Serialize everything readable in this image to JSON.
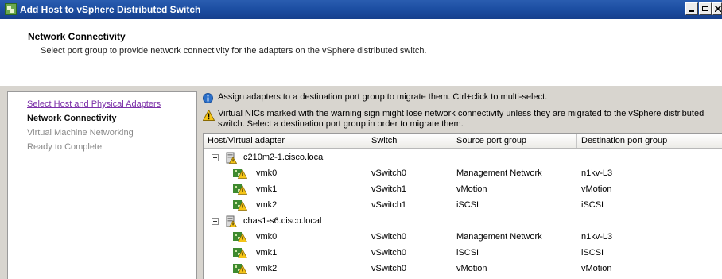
{
  "window": {
    "title": "Add Host to vSphere Distributed Switch"
  },
  "header": {
    "title": "Network Connectivity",
    "subtitle": "Select port group to provide network connectivity for the adapters on the vSphere distributed switch."
  },
  "steps": [
    {
      "label": "Select Host and Physical Adapters",
      "state": "link"
    },
    {
      "label": "Network Connectivity",
      "state": "current"
    },
    {
      "label": "Virtual Machine Networking",
      "state": "disabled"
    },
    {
      "label": "Ready to Complete",
      "state": "disabled"
    }
  ],
  "info_text": "Assign adapters to a destination port group to migrate them. Ctrl+click to multi-select.",
  "warning_text": "Virtual NICs marked with the warning sign might lose network connectivity unless they are migrated to the vSphere distributed switch. Select a destination port group in order to migrate them.",
  "table": {
    "columns": [
      "Host/Virtual adapter",
      "Switch",
      "Source port group",
      "Destination port group"
    ],
    "rows": [
      {
        "type": "host",
        "name": "c210m2-1.cisco.local"
      },
      {
        "type": "adapter",
        "name": "vmk0",
        "switch": "vSwitch0",
        "source": "Management Network",
        "destination": "n1kv-L3"
      },
      {
        "type": "adapter",
        "name": "vmk1",
        "switch": "vSwitch1",
        "source": "vMotion",
        "destination": "vMotion"
      },
      {
        "type": "adapter",
        "name": "vmk2",
        "switch": "vSwitch1",
        "source": "iSCSI",
        "destination": "iSCSI"
      },
      {
        "type": "host",
        "name": "chas1-s6.cisco.local"
      },
      {
        "type": "adapter",
        "name": "vmk0",
        "switch": "vSwitch0",
        "source": "Management Network",
        "destination": "n1kv-L3"
      },
      {
        "type": "adapter",
        "name": "vmk1",
        "switch": "vSwitch0",
        "source": "iSCSI",
        "destination": "iSCSI"
      },
      {
        "type": "adapter",
        "name": "vmk2",
        "switch": "vSwitch0",
        "source": "vMotion",
        "destination": "vMotion"
      }
    ]
  },
  "colors": {
    "titlebar": "#1d4fa3",
    "link": "#7b2fa8",
    "panel_bg": "#d8d5cf"
  },
  "icons": {
    "app": "vsphere-app-icon",
    "info": "info-icon",
    "warning": "warning-icon",
    "host": "host-warning-icon",
    "adapter": "vmkernel-nic-warning-icon"
  }
}
